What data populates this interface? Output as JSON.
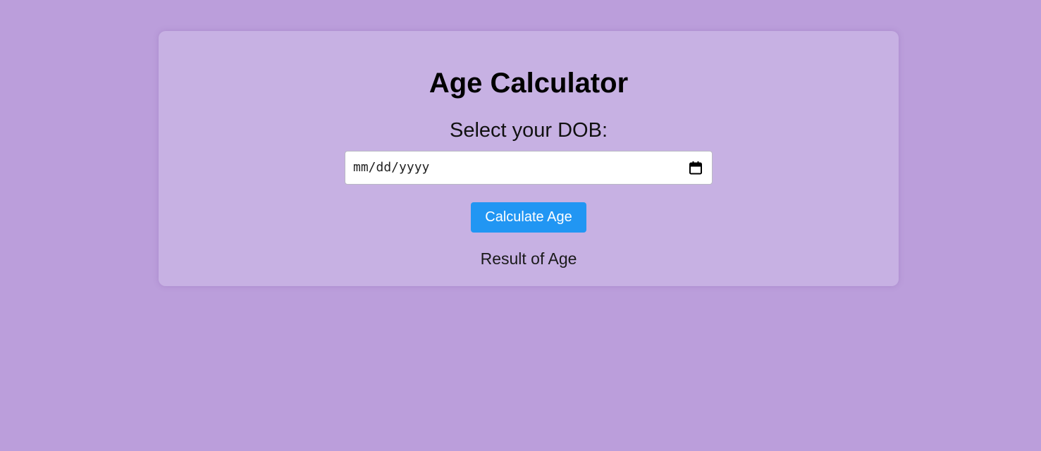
{
  "app": {
    "title": "Age Calculator"
  },
  "form": {
    "dob_label": "Select your DOB:",
    "date_placeholder": "mm/dd/yyyy",
    "date_value": "",
    "calendar_icon": "calendar-icon",
    "calculate_label": "Calculate Age"
  },
  "result": {
    "text": "Result of Age"
  },
  "colors": {
    "page_background": "#bb9edb",
    "card_background": "#c7b1e3",
    "button_background": "#2196f3",
    "button_text": "#ffffff"
  }
}
